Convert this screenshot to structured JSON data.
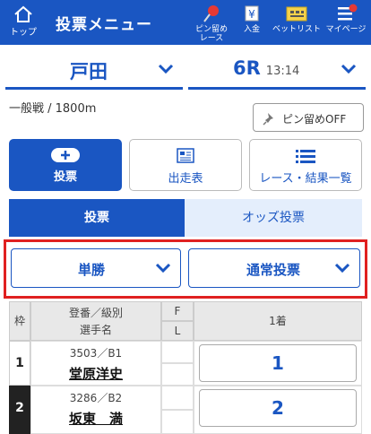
{
  "header": {
    "home_label": "トップ",
    "title": "投票メニュー",
    "items": [
      {
        "label": "ピン留め\nレース",
        "icon": "pin-icon"
      },
      {
        "label": "入金",
        "icon": "deposit-icon"
      },
      {
        "label": "ベットリスト",
        "icon": "bet-list-icon"
      },
      {
        "label": "マイページ",
        "icon": "menu-icon"
      }
    ]
  },
  "venue": {
    "name": "戸田"
  },
  "race": {
    "number": "6R",
    "time": "13:14"
  },
  "meta": "一般戦 / 1800m",
  "pin_button": "ピン留めOFF",
  "menu": [
    {
      "label": "投票"
    },
    {
      "label": "出走表"
    },
    {
      "label": "レース・結果一覧"
    }
  ],
  "tabs": [
    "投票",
    "オッズ投票"
  ],
  "dropdowns": {
    "bet_type": "単勝",
    "method": "通常投票"
  },
  "table": {
    "col_frame": "枠",
    "col_racer_line1": "登番／級別",
    "col_racer_line2": "選手名",
    "col_f": "F",
    "col_l": "L",
    "col_first": "1着",
    "rows": [
      {
        "frame": "1",
        "reg": "3503／B1",
        "name": "堂原洋史",
        "pick": "1"
      },
      {
        "frame": "2",
        "reg": "3286／B2",
        "name": "坂東　満",
        "pick": "2"
      }
    ]
  },
  "colors": {
    "accent": "#1a56c2",
    "highlight": "#e02020"
  }
}
